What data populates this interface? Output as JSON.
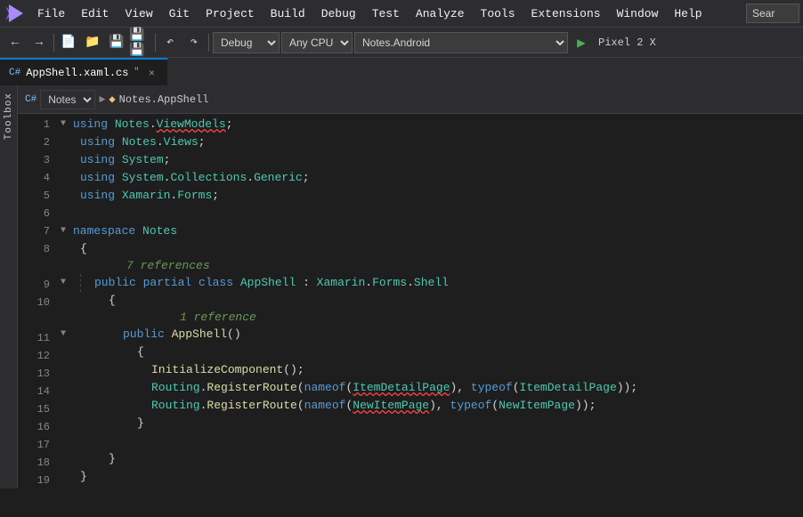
{
  "menuBar": {
    "items": [
      "File",
      "Edit",
      "View",
      "Git",
      "Project",
      "Build",
      "Debug",
      "Test",
      "Analyze",
      "Tools",
      "Extensions",
      "Window",
      "Help"
    ],
    "searchPlaceholder": "Sear"
  },
  "toolbar": {
    "debugConfig": "Debug",
    "platform": "Any CPU",
    "project": "Notes.Android",
    "runTarget": "Pixel 2 X",
    "buttons": [
      "↩",
      "→",
      "⟳",
      "|",
      "⊞",
      "⤴",
      "⤵",
      "⟳",
      "|",
      "⏵",
      "|"
    ]
  },
  "tabs": [
    {
      "label": "AppShell.xaml.cs",
      "active": true
    },
    {
      "label": "Notes.AppShell",
      "active": false
    }
  ],
  "breadcrumb": {
    "namespace": "Notes",
    "class": "Notes.AppShell"
  },
  "codeLines": [
    {
      "num": 1,
      "fold": "▼",
      "indent": 0,
      "tokens": [
        {
          "t": "using ",
          "c": "kw"
        },
        {
          "t": "Notes",
          "c": "ns"
        },
        {
          "t": ".",
          "c": "plain"
        },
        {
          "t": "ViewModels",
          "c": "squiggle ns"
        },
        {
          "t": ";",
          "c": "plain"
        }
      ]
    },
    {
      "num": 2,
      "fold": "",
      "indent": 1,
      "tokens": [
        {
          "t": "using ",
          "c": "kw"
        },
        {
          "t": "Notes",
          "c": "ns"
        },
        {
          "t": ".",
          "c": "plain"
        },
        {
          "t": "Views",
          "c": "ns"
        },
        {
          "t": ";",
          "c": "plain"
        }
      ]
    },
    {
      "num": 3,
      "fold": "",
      "indent": 1,
      "tokens": [
        {
          "t": "using ",
          "c": "kw"
        },
        {
          "t": "System",
          "c": "ns"
        },
        {
          "t": ";",
          "c": "plain"
        }
      ]
    },
    {
      "num": 4,
      "fold": "",
      "indent": 1,
      "tokens": [
        {
          "t": "using ",
          "c": "kw"
        },
        {
          "t": "System",
          "c": "ns"
        },
        {
          "t": ".",
          "c": "plain"
        },
        {
          "t": "Collections",
          "c": "ns"
        },
        {
          "t": ".",
          "c": "plain"
        },
        {
          "t": "Generic",
          "c": "ns"
        },
        {
          "t": ";",
          "c": "plain"
        }
      ]
    },
    {
      "num": 5,
      "fold": "",
      "indent": 1,
      "tokens": [
        {
          "t": "using ",
          "c": "kw"
        },
        {
          "t": "Xamarin",
          "c": "ns"
        },
        {
          "t": ".",
          "c": "plain"
        },
        {
          "t": "Forms",
          "c": "ns"
        },
        {
          "t": ";",
          "c": "plain"
        }
      ]
    },
    {
      "num": 6,
      "fold": "",
      "indent": 0,
      "tokens": []
    },
    {
      "num": 7,
      "fold": "▼",
      "indent": 0,
      "tokens": [
        {
          "t": "namespace ",
          "c": "kw"
        },
        {
          "t": "Notes",
          "c": "class-name"
        }
      ]
    },
    {
      "num": 8,
      "fold": "",
      "indent": 1,
      "tokens": [
        {
          "t": "{",
          "c": "plain"
        }
      ]
    },
    {
      "num": "7refs",
      "fold": "",
      "indent": 0,
      "tokens": [],
      "comment": "7 references"
    },
    {
      "num": 9,
      "fold": "▼",
      "indent": 2,
      "tokens": [
        {
          "t": "public ",
          "c": "kw"
        },
        {
          "t": "partial ",
          "c": "kw"
        },
        {
          "t": "class ",
          "c": "kw"
        },
        {
          "t": "AppShell",
          "c": "class-name"
        },
        {
          "t": " : ",
          "c": "plain"
        },
        {
          "t": "Xamarin",
          "c": "ns"
        },
        {
          "t": ".",
          "c": "plain"
        },
        {
          "t": "Forms",
          "c": "ns"
        },
        {
          "t": ".",
          "c": "plain"
        },
        {
          "t": "Shell",
          "c": "class-name"
        }
      ]
    },
    {
      "num": 10,
      "fold": "",
      "indent": 3,
      "tokens": [
        {
          "t": "{",
          "c": "plain"
        }
      ]
    },
    {
      "num": "1ref",
      "fold": "",
      "indent": 0,
      "tokens": [],
      "comment": "1 reference"
    },
    {
      "num": 11,
      "fold": "▼",
      "indent": 4,
      "tokens": [
        {
          "t": "public ",
          "c": "kw"
        },
        {
          "t": "AppShell",
          "c": "method"
        },
        {
          "t": "()",
          "c": "plain"
        }
      ]
    },
    {
      "num": 12,
      "fold": "",
      "indent": 5,
      "tokens": [
        {
          "t": "{",
          "c": "plain"
        }
      ]
    },
    {
      "num": 13,
      "fold": "",
      "indent": 6,
      "tokens": [
        {
          "t": "InitializeComponent",
          "c": "method"
        },
        {
          "t": "();",
          "c": "plain"
        }
      ]
    },
    {
      "num": 14,
      "fold": "",
      "indent": 6,
      "tokens": [
        {
          "t": "Routing",
          "c": "class-name"
        },
        {
          "t": ".",
          "c": "plain"
        },
        {
          "t": "RegisterRoute",
          "c": "method"
        },
        {
          "t": "(",
          "c": "plain"
        },
        {
          "t": "nameof",
          "c": "kw"
        },
        {
          "t": "(",
          "c": "plain"
        },
        {
          "t": "ItemDetailPage",
          "c": "squiggle class-name"
        },
        {
          "t": "), ",
          "c": "plain"
        },
        {
          "t": "typeof",
          "c": "kw"
        },
        {
          "t": "(",
          "c": "plain"
        },
        {
          "t": "ItemDetailPage",
          "c": "class-name"
        },
        {
          "t": "));",
          "c": "plain"
        }
      ]
    },
    {
      "num": 15,
      "fold": "",
      "indent": 6,
      "tokens": [
        {
          "t": "Routing",
          "c": "class-name"
        },
        {
          "t": ".",
          "c": "plain"
        },
        {
          "t": "RegisterRoute",
          "c": "method"
        },
        {
          "t": "(",
          "c": "plain"
        },
        {
          "t": "nameof",
          "c": "kw"
        },
        {
          "t": "(",
          "c": "plain"
        },
        {
          "t": "NewItemPage",
          "c": "squiggle class-name"
        },
        {
          "t": "), ",
          "c": "plain"
        },
        {
          "t": "typeof",
          "c": "kw"
        },
        {
          "t": "(",
          "c": "plain"
        },
        {
          "t": "NewItemPage",
          "c": "class-name"
        },
        {
          "t": "));",
          "c": "plain"
        }
      ]
    },
    {
      "num": 16,
      "fold": "",
      "indent": 5,
      "tokens": [
        {
          "t": "}",
          "c": "plain"
        }
      ]
    },
    {
      "num": 17,
      "fold": "",
      "indent": 0,
      "tokens": []
    },
    {
      "num": 18,
      "fold": "",
      "indent": 3,
      "tokens": [
        {
          "t": "}",
          "c": "plain"
        }
      ]
    },
    {
      "num": 19,
      "fold": "",
      "indent": 1,
      "tokens": [
        {
          "t": "}",
          "c": "plain"
        }
      ]
    }
  ],
  "toolbox": {
    "label": "Toolbox"
  }
}
